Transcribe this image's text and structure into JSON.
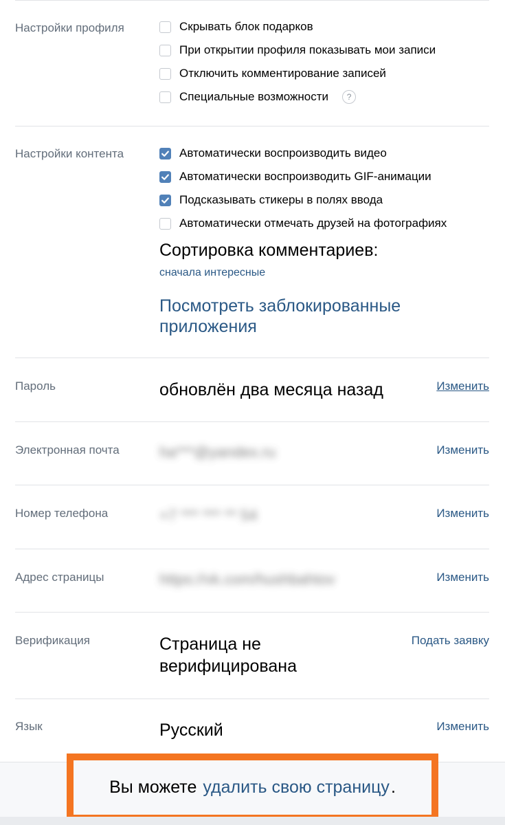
{
  "profile_settings": {
    "label": "Настройки профиля",
    "options": [
      {
        "text": "Скрывать блок подарков",
        "checked": false
      },
      {
        "text": "При открытии профиля показывать мои записи",
        "checked": false
      },
      {
        "text": "Отключить комментирование записей",
        "checked": false
      },
      {
        "text": "Специальные возможности",
        "checked": false
      }
    ],
    "help_glyph": "?"
  },
  "content_settings": {
    "label": "Настройки контента",
    "options": [
      {
        "text": "Автоматически воспроизводить видео",
        "checked": true
      },
      {
        "text": "Автоматически воспроизводить GIF-анимации",
        "checked": true
      },
      {
        "text": "Подсказывать стикеры в полях ввода",
        "checked": true
      },
      {
        "text": "Автоматически отмечать друзей на фотографиях",
        "checked": false
      }
    ],
    "sort_title": "Сортировка комментариев:",
    "sort_value": "сначала интересные",
    "blocked_apps_link": "Посмотреть заблокированные приложения"
  },
  "password": {
    "label": "Пароль",
    "value": "обновлён два месяца назад",
    "action": "Изменить"
  },
  "email": {
    "label": "Электронная почта",
    "value": "ha***@yandex.ru",
    "action": "Изменить"
  },
  "phone": {
    "label": "Номер телефона",
    "value": "+7 *** *** ** 54",
    "action": "Изменить"
  },
  "page_address": {
    "label": "Адрес страницы",
    "value": "https://vk.com/hushbahtov",
    "action": "Изменить"
  },
  "verification": {
    "label": "Верификация",
    "value": "Страница не верифицирована",
    "action": "Подать заявку"
  },
  "language": {
    "label": "Язык",
    "value": "Русский",
    "action": "Изменить"
  },
  "footer": {
    "prefix": "Вы можете",
    "link": "удалить свою страницу",
    "suffix": "."
  },
  "colors": {
    "accent": "#5181b8",
    "link": "#2a5885",
    "highlight": "#f47521",
    "label": "#626d7a"
  }
}
